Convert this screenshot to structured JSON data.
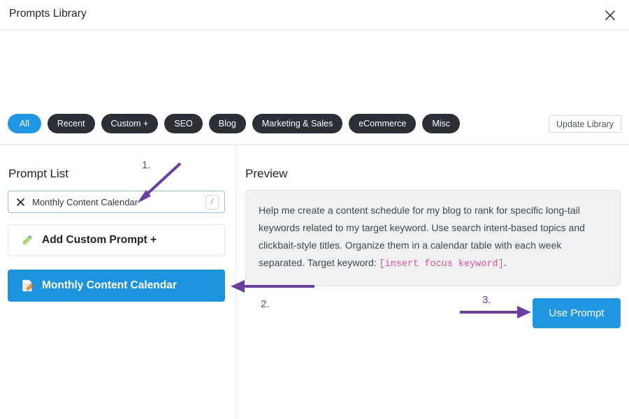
{
  "window": {
    "title": "Prompts Library",
    "close_icon": "close-icon"
  },
  "filters": {
    "pills": [
      {
        "label": "All",
        "active": true
      },
      {
        "label": "Recent",
        "active": false
      },
      {
        "label": "Custom +",
        "active": false
      },
      {
        "label": "SEO",
        "active": false
      },
      {
        "label": "Blog",
        "active": false
      },
      {
        "label": "Marketing & Sales",
        "active": false
      },
      {
        "label": "eCommerce",
        "active": false
      },
      {
        "label": "Misc",
        "active": false
      }
    ],
    "update_library_label": "Update Library"
  },
  "left_pane": {
    "title": "Prompt List",
    "search": {
      "value": "Monthly Content Calendar",
      "placeholder": "Search prompts",
      "clear_icon": "close-icon",
      "shortcut_key": "/"
    },
    "add_custom": {
      "label": "Add Custom Prompt +",
      "icon": "test-tube-icon"
    },
    "items": [
      {
        "label": "Monthly Content Calendar",
        "icon": "memo-pencil-icon",
        "selected": true
      }
    ]
  },
  "right_pane": {
    "title": "Preview",
    "prompt_text_part1": "Help me create a content schedule for my blog to rank for specific long-tail keywords related to my target keyword. Use search intent-based topics and clickbait-style titles. Organize them in a calendar table with each week separated. Target keyword: ",
    "prompt_keyword": "[insert focus keyword]",
    "prompt_text_part2": ".",
    "use_prompt_label": "Use Prompt"
  },
  "annotations": {
    "step1": "1.",
    "step2": "2.",
    "step3": "3.",
    "color": "#6b3fa0"
  },
  "colors": {
    "accent_blue": "#2196e3",
    "selected_item_blue": "#1e93dd",
    "pill_dark": "#2b2f36",
    "preview_bg": "#eff1f2",
    "keyword_pink": "#e0509a",
    "annotation_purple": "#6b3fa0"
  }
}
